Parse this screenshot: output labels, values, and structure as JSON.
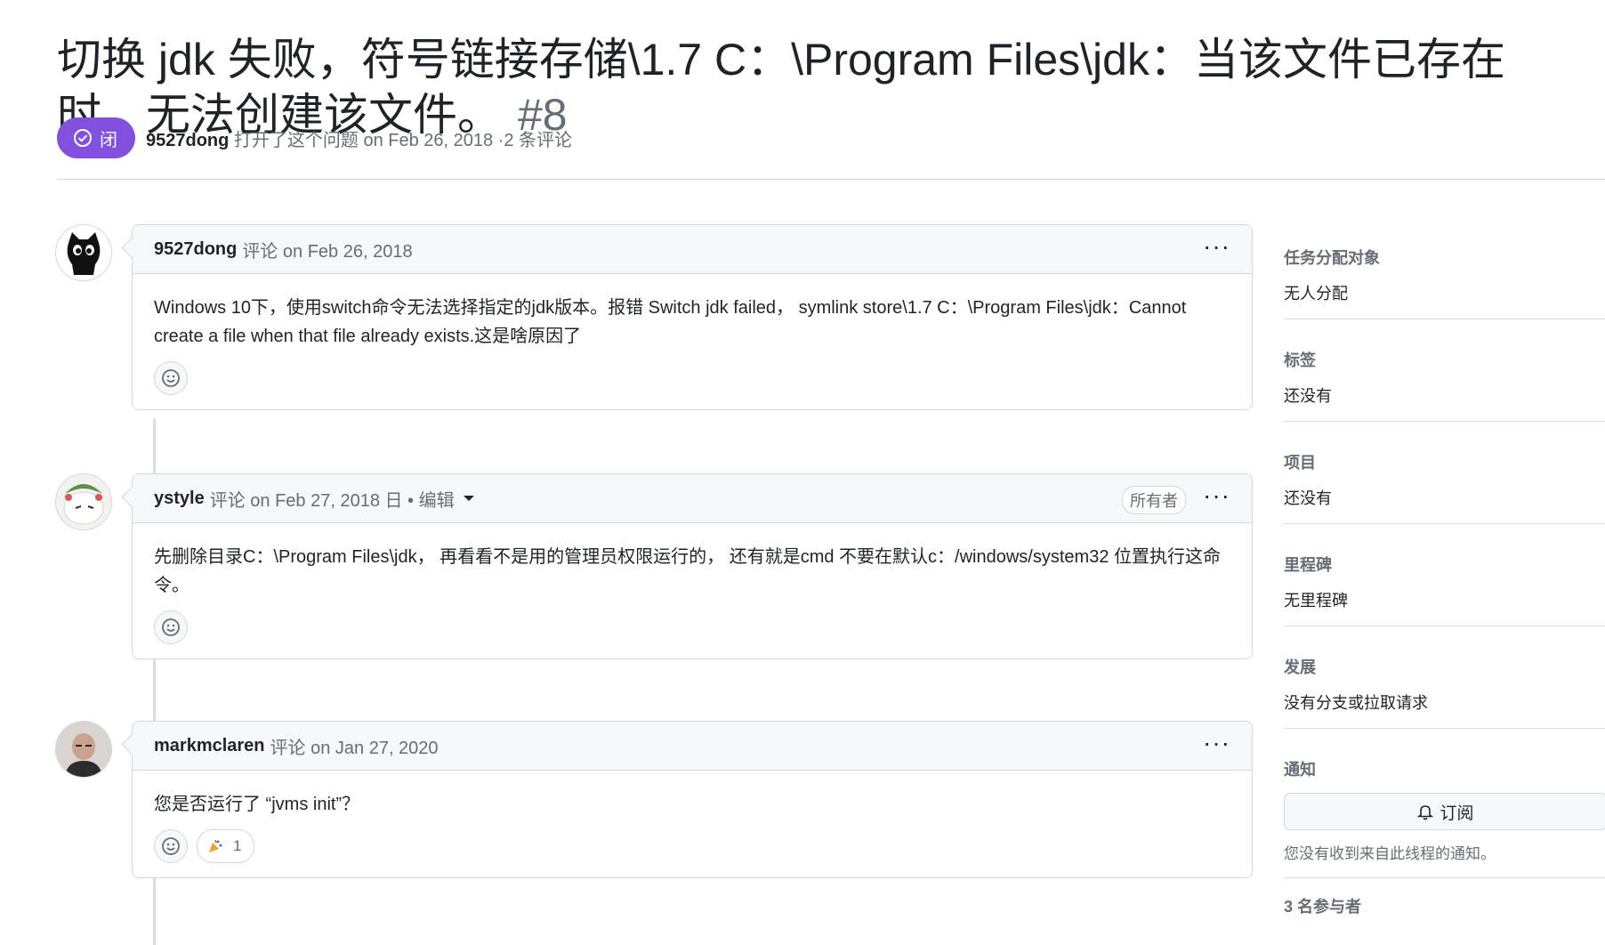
{
  "issue": {
    "title": "切换 jdk 失败，符号链接存储\\1.7 C：\\Program Files\\jdk：当该文件已存在时，无法创建该文件。",
    "number": "#8",
    "state": "闭",
    "author": "9527dong",
    "opened_text": "打开了这个问题 on Feb 26, 2018 ·2 条评论"
  },
  "comments": [
    {
      "author": "9527dong",
      "action": "评论 on Feb 26, 2018",
      "body": "Windows 10下，使用switch命令无法选择指定的jdk版本。报错 Switch jdk failed， symlink store\\1.7 C：\\Program Files\\jdk：Cannot create a file when that file already exists.这是啥原因了",
      "menu": "···"
    },
    {
      "author": "ystyle",
      "action": "评论 on Feb 27, 2018 日 • 编辑",
      "badge": "所有者",
      "body": "先删除目录C：\\Program Files\\jdk， 再看看不是用的管理员权限运行的， 还有就是cmd 不要在默认c：/windows/system32 位置执行这命令。",
      "menu": "···"
    },
    {
      "author": "markmclaren",
      "action": "评论 on Jan 27, 2020",
      "body": "您是否运行了 “jvms init”？",
      "menu": "···",
      "reaction_count": "1"
    }
  ],
  "sidebar": {
    "assignees_h": "任务分配对象",
    "assignees_v": "无人分配",
    "labels_h": "标签",
    "labels_v": "还没有",
    "projects_h": "项目",
    "projects_v": "还没有",
    "milestone_h": "里程碑",
    "milestone_v": "无里程碑",
    "development_h": "发展",
    "development_v": "没有分支或拉取请求",
    "notify_h": "通知",
    "subscribe_label": "订阅",
    "notify_note": "您没有收到来自此线程的通知。",
    "participants_h": "3 名参与者"
  },
  "colors": {
    "closed_badge": "#8250df",
    "border": "#d0d7de",
    "muted": "#656d76"
  }
}
